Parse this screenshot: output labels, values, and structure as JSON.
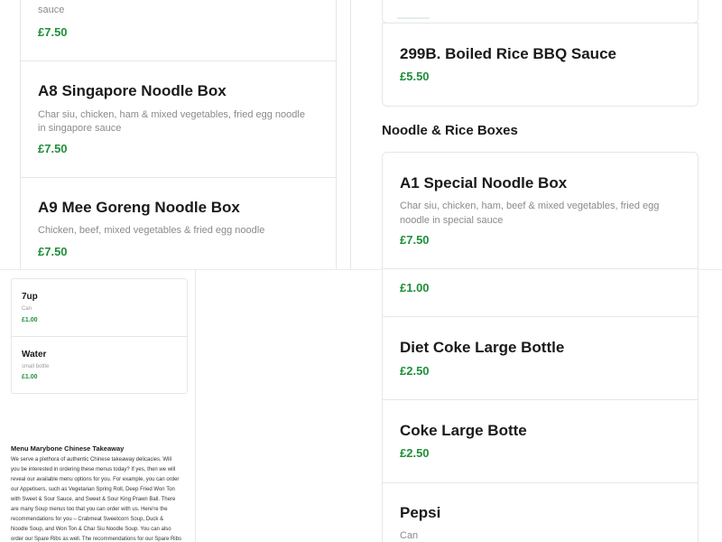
{
  "left_column": {
    "partial_top": {
      "desc_tail": "sauce",
      "price": "£7.50"
    },
    "items": [
      {
        "name": "A8 Singapore Noodle Box",
        "desc": "Char siu, chicken, ham & mixed vegetables, fried egg noodle in singapore sauce",
        "price": "£7.50"
      },
      {
        "name": "A9 Mee Goreng Noodle Box",
        "desc": "Chicken, beef, mixed vegetables & fried egg noodle",
        "price": "£7.50"
      }
    ]
  },
  "right_column": {
    "top_item": {
      "name": "299B. Boiled Rice BBQ Sauce",
      "price": "£5.50"
    },
    "section_heading": "Noodle & Rice Boxes",
    "a1": {
      "name": "A1 Special Noodle Box",
      "desc": "Char siu, chicken, ham, beef & mixed vegetables, fried egg noodle in special sauce",
      "price": "£7.50"
    }
  },
  "drinks_small": [
    {
      "name": "7up",
      "desc": "Can",
      "price": "£1.00"
    },
    {
      "name": "Water",
      "desc": "small bottle",
      "price": "£1.00"
    }
  ],
  "drinks_right": {
    "partial_price": "£1.00",
    "items": [
      {
        "name": "Diet Coke Large Bottle",
        "price": "£2.50"
      },
      {
        "name": "Coke Large Botte",
        "price": "£2.50"
      },
      {
        "name": "Pepsi",
        "desc": "Can"
      }
    ]
  },
  "about": {
    "title": "Menu Marybone Chinese Takeaway",
    "lines": [
      "We serve a plethora of authentic Chinese takeaway delicacies. Will",
      "you be interested in ordering these menus today? If yes, then we will",
      "reveal our available menu options for you. For example, you can order",
      "our Appetisers, such as Vegetarian Spring Roll, Deep Fried Won Ton",
      "with Sweet & Sour Sauce, and Sweet & Sour King Prawn Ball. There",
      "are many Soup menus too that you can order with us. Here're the",
      "recommendations for you – Crabmeat Sweetcorn Soup, Duck &",
      "Noodle Soup, and Won Ton & Char Siu Noodle Soup. You can also",
      "order our Spare Ribs as well. The recommendations for our Spare Ribs"
    ]
  }
}
